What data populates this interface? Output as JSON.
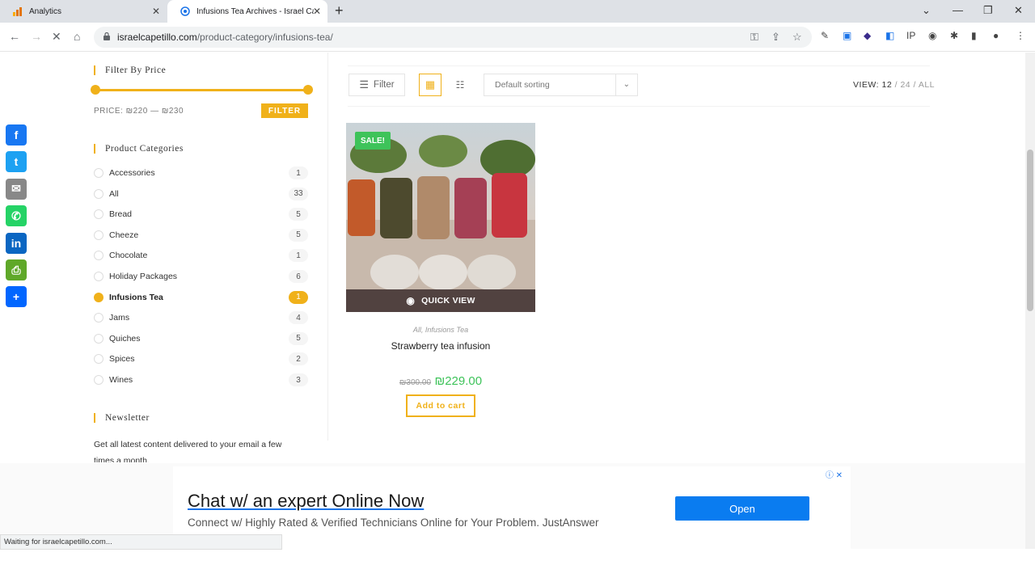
{
  "browser": {
    "tabs": [
      {
        "title": "Analytics",
        "active": false
      },
      {
        "title": "Infusions Tea Archives - Israel Ca",
        "active": true
      }
    ],
    "url_host": "israelcapetillo.com",
    "url_path": "/product-category/infusions-tea/",
    "status_text": "Waiting for israelcapetillo.com..."
  },
  "share_buttons": [
    {
      "name": "Facebook",
      "glyph": "f",
      "color": "#1877f2"
    },
    {
      "name": "Twitter",
      "glyph": "t",
      "color": "#1da1f2"
    },
    {
      "name": "Email",
      "glyph": "✉",
      "color": "#888888"
    },
    {
      "name": "WhatsApp",
      "glyph": "✆",
      "color": "#25d366"
    },
    {
      "name": "LinkedIn",
      "glyph": "in",
      "color": "#0a66c2"
    },
    {
      "name": "Print",
      "glyph": "⎙",
      "color": "#5fa829"
    },
    {
      "name": "Share",
      "glyph": "+",
      "color": "#0166ff"
    }
  ],
  "sidebar": {
    "price_title": "Filter By Price",
    "price_label": "PRICE: ₪220 — ₪230",
    "filter_button": "FILTER",
    "categories_title": "Product Categories",
    "categories": [
      {
        "label": "Accessories",
        "count": "1"
      },
      {
        "label": "All",
        "count": "33"
      },
      {
        "label": "Bread",
        "count": "5"
      },
      {
        "label": "Cheeze",
        "count": "5"
      },
      {
        "label": "Chocolate",
        "count": "1"
      },
      {
        "label": "Holiday Packages",
        "count": "6"
      },
      {
        "label": "Infusions Tea",
        "count": "1",
        "active": true
      },
      {
        "label": "Jams",
        "count": "4"
      },
      {
        "label": "Quiches",
        "count": "5"
      },
      {
        "label": "Spices",
        "count": "2"
      },
      {
        "label": "Wines",
        "count": "3"
      }
    ],
    "newsletter_title": "Newsletter",
    "newsletter_text": "Get all latest content delivered to your email a few times a month."
  },
  "toolbar": {
    "filter_label": "Filter",
    "sort_value": "Default sorting",
    "view_label": "VIEW:",
    "view_12": "12",
    "view_24": "24",
    "view_all": "ALL",
    "view_sep": "/"
  },
  "product": {
    "badge": "SALE!",
    "quick_view": "QUICK VIEW",
    "categories": "All, Infusions Tea",
    "title": "Strawberry tea infusion",
    "old_price": "₪300.00",
    "new_price": "₪229.00",
    "add_to_cart": "Add to cart"
  },
  "ad": {
    "headline": "Chat w/ an expert Online Now",
    "subline": "Connect w/ Highly Rated & Verified Technicians Online for Your Problem. JustAnswer",
    "button": "Open"
  },
  "colors": {
    "accent": "#f0b11a",
    "sale": "#3ec35a",
    "ad_button": "#0a7cf0"
  }
}
